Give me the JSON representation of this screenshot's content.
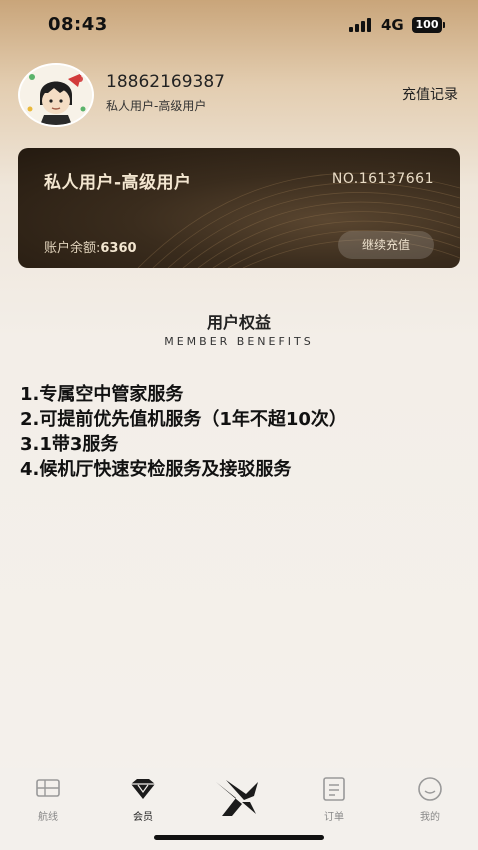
{
  "status_bar": {
    "time": "08:43",
    "network": "4G",
    "battery": "100"
  },
  "profile": {
    "phone": "18862169387",
    "user_type": "私人用户-高级用户",
    "recharge_record_label": "充值记录"
  },
  "card": {
    "level": "私人用户-高级用户",
    "number": "NO.16137661",
    "balance_label": "账户余额:",
    "balance_value": "6360",
    "recharge_button": "继续充值"
  },
  "benefits": {
    "title": "用户权益",
    "subtitle": "MEMBER BENEFITS",
    "items": [
      "1.专属空中管家服务",
      "2.可提前优先值机服务（1年不超10次）",
      "3.1带3服务",
      "4.候机厅快速安检服务及接驳服务"
    ]
  },
  "tabbar": {
    "tabs": [
      {
        "label": "航线",
        "icon": "route-icon"
      },
      {
        "label": "会员",
        "icon": "diamond-icon"
      },
      {
        "label": "",
        "icon": "logo-icon"
      },
      {
        "label": "订单",
        "icon": "order-icon"
      },
      {
        "label": "我的",
        "icon": "smiley-icon"
      }
    ],
    "active": "会员"
  }
}
